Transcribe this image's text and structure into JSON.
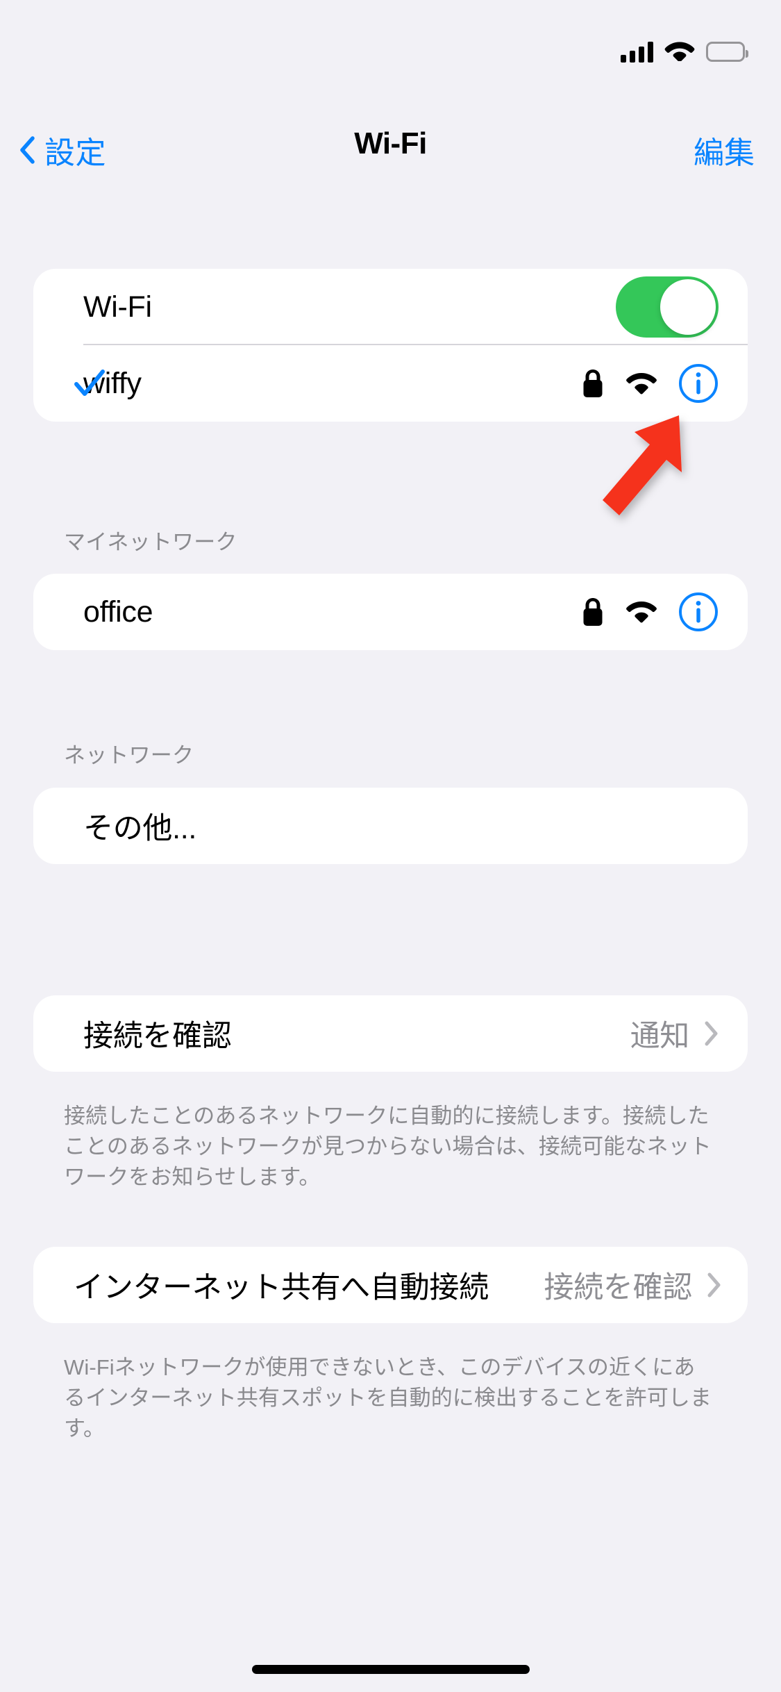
{
  "statusbar": {
    "cellular_icon": "cellular-signal-icon",
    "wifi_icon": "wifi-icon",
    "battery_icon": "battery-icon"
  },
  "navbar": {
    "back_label": "設定",
    "title": "Wi-Fi",
    "edit_label": "編集"
  },
  "wifi_toggle_row": {
    "label": "Wi-Fi",
    "state": "on"
  },
  "connected_network": {
    "name": "wiffy",
    "checked": true,
    "secured": true,
    "signal": "wifi-full"
  },
  "my_networks": {
    "header": "マイネットワーク",
    "items": [
      {
        "name": "office",
        "secured": true,
        "signal": "wifi-full"
      }
    ]
  },
  "networks": {
    "header": "ネットワーク",
    "other_label": "その他..."
  },
  "ask_to_join": {
    "label": "接続を確認",
    "value": "通知",
    "footnote": "接続したことのあるネットワークに自動的に接続します。接続したことのあるネットワークが見つからない場合は、接続可能なネットワークをお知らせします。"
  },
  "auto_join_hotspot": {
    "label": "インターネット共有へ自動接続",
    "value": "接続を確認",
    "footnote": "Wi-Fiネットワークが使用できないとき、このデバイスの近くにあるインターネット共有スポットを自動的に検出することを許可します。"
  },
  "annotation": {
    "arrow_color": "#f5321e",
    "points_at": "info-button-wiffy"
  },
  "colors": {
    "accent": "#0a84ff",
    "toggle_on": "#34c759",
    "background": "#f2f1f6",
    "card": "#ffffff",
    "secondary_text": "#8a8a8e"
  }
}
